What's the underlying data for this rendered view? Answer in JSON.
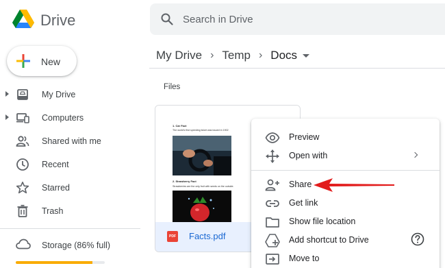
{
  "app": {
    "brand": "Drive"
  },
  "search": {
    "placeholder": "Search in Drive"
  },
  "sidebar": {
    "new_label": "New",
    "items": [
      {
        "label": "My Drive",
        "icon": "my-drive-icon",
        "expandable": true
      },
      {
        "label": "Computers",
        "icon": "computers-icon",
        "expandable": true
      },
      {
        "label": "Shared with me",
        "icon": "shared-with-me-icon",
        "expandable": false
      },
      {
        "label": "Recent",
        "icon": "clock-icon",
        "expandable": false
      },
      {
        "label": "Starred",
        "icon": "star-icon",
        "expandable": false
      },
      {
        "label": "Trash",
        "icon": "trash-icon",
        "expandable": false
      }
    ],
    "storage_label": "Storage (86% full)",
    "storage_fraction": 0.86
  },
  "breadcrumb": [
    "My Drive",
    "Temp",
    "Docs"
  ],
  "section_label": "Files",
  "file": {
    "name": "Facts.pdf",
    "type_badge": "PDF",
    "preview": {
      "heading1": "1. Car Fact",
      "text1": "The world's first speeding ticket was issued in 1902",
      "heading2": "2. Strawberry Fact",
      "text2": "Strawberries are the only fruit with seeds on the outside."
    }
  },
  "context_menu": {
    "items": [
      {
        "label": "Preview",
        "icon": "eye-icon"
      },
      {
        "label": "Open with",
        "icon": "open-with-icon",
        "submenu": true
      },
      {
        "label": "Share",
        "icon": "share-person-icon"
      },
      {
        "label": "Get link",
        "icon": "link-icon"
      },
      {
        "label": "Show file location",
        "icon": "folder-icon"
      },
      {
        "label": "Add shortcut to Drive",
        "icon": "add-shortcut-icon",
        "help": true
      },
      {
        "label": "Move to",
        "icon": "move-to-icon"
      }
    ]
  },
  "colors": {
    "accent_blue": "#1967d2",
    "selected_bg": "#e8f0fe",
    "annotation_arrow": "#e21c1c",
    "storage_bar": "#f9ab00"
  }
}
